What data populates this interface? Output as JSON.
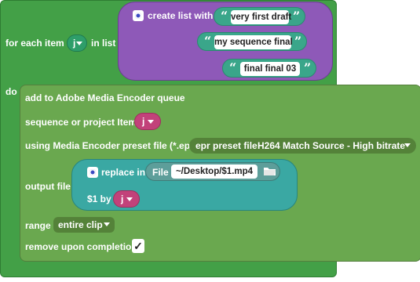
{
  "for_each": {
    "label_prefix": "for each item",
    "variable": "j",
    "label_suffix": "in list",
    "do_label": "do"
  },
  "create_list": {
    "label": "create list with",
    "items": [
      "very first draft",
      "my sequence final",
      "final final 03"
    ],
    "open_quote": "“",
    "close_quote": "”"
  },
  "queue_block": {
    "title": "add to Adobe Media Encoder queue",
    "sequence_label": "sequence or project Item",
    "sequence_var": "j",
    "preset_label": "using Media Encoder preset file (*.epr)",
    "preset_prefix": "epr preset file",
    "preset_value": "H264 Match Source - High bitrate",
    "output_label": "output file",
    "replace_label": "replace in",
    "file_label": "File",
    "file_path": "~/Desktop/$1.mp4",
    "by_label": "$1 by",
    "by_var": "j",
    "range_label": "range",
    "range_value": "entire clip",
    "remove_label": "remove upon completion",
    "remove_checked": "✓"
  },
  "colors": {
    "outer_block": "#43a047",
    "list_block": "#8e59b8",
    "string_chip": "#3aa68a",
    "variable_pill": "#c2427a",
    "inner_block": "#6aa84f",
    "replace_block": "#3aa8a3"
  }
}
